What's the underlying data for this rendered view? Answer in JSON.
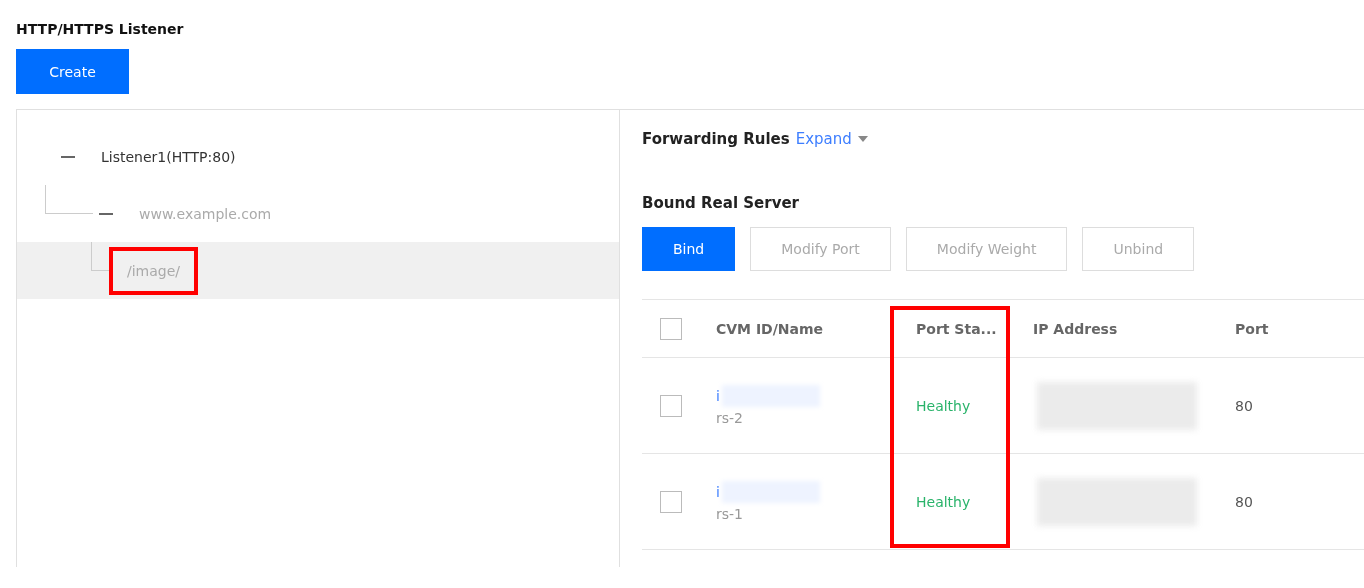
{
  "title": "HTTP/HTTPS Listener",
  "create_button": "Create",
  "tree": [
    {
      "label": "Listener1(HTTP:80)",
      "expanded": true,
      "selected": false,
      "children": [
        {
          "label": "www.example.com",
          "expanded": true,
          "selected": false,
          "children": [
            {
              "label": "/image/",
              "selected": true,
              "highlighted": true
            }
          ]
        }
      ]
    }
  ],
  "forwarding_rules": {
    "title": "Forwarding Rules",
    "toggle": "Expand"
  },
  "bound_real_server": {
    "title": "Bound Real Server",
    "buttons": [
      {
        "label": "Bind",
        "kind": "primary",
        "disabled": false
      },
      {
        "label": "Modify Port",
        "kind": "default",
        "disabled": true
      },
      {
        "label": "Modify Weight",
        "kind": "default",
        "disabled": true
      },
      {
        "label": "Unbind",
        "kind": "default",
        "disabled": true
      }
    ]
  },
  "table": {
    "header_checked": false,
    "columns": [
      {
        "label": "CVM ID/Name",
        "highlighted": false
      },
      {
        "label": "Port Sta...",
        "highlighted": true
      },
      {
        "label": "IP Address",
        "highlighted": false
      },
      {
        "label": "Port",
        "highlighted": false
      }
    ],
    "rows": [
      {
        "checked": false,
        "cvm_id": "i",
        "cvm_name": "rs-2",
        "port_status": "Healthy",
        "port": "80"
      },
      {
        "checked": false,
        "cvm_id": "i",
        "cvm_name": "rs-1",
        "port_status": "Healthy",
        "port": "80"
      }
    ]
  }
}
